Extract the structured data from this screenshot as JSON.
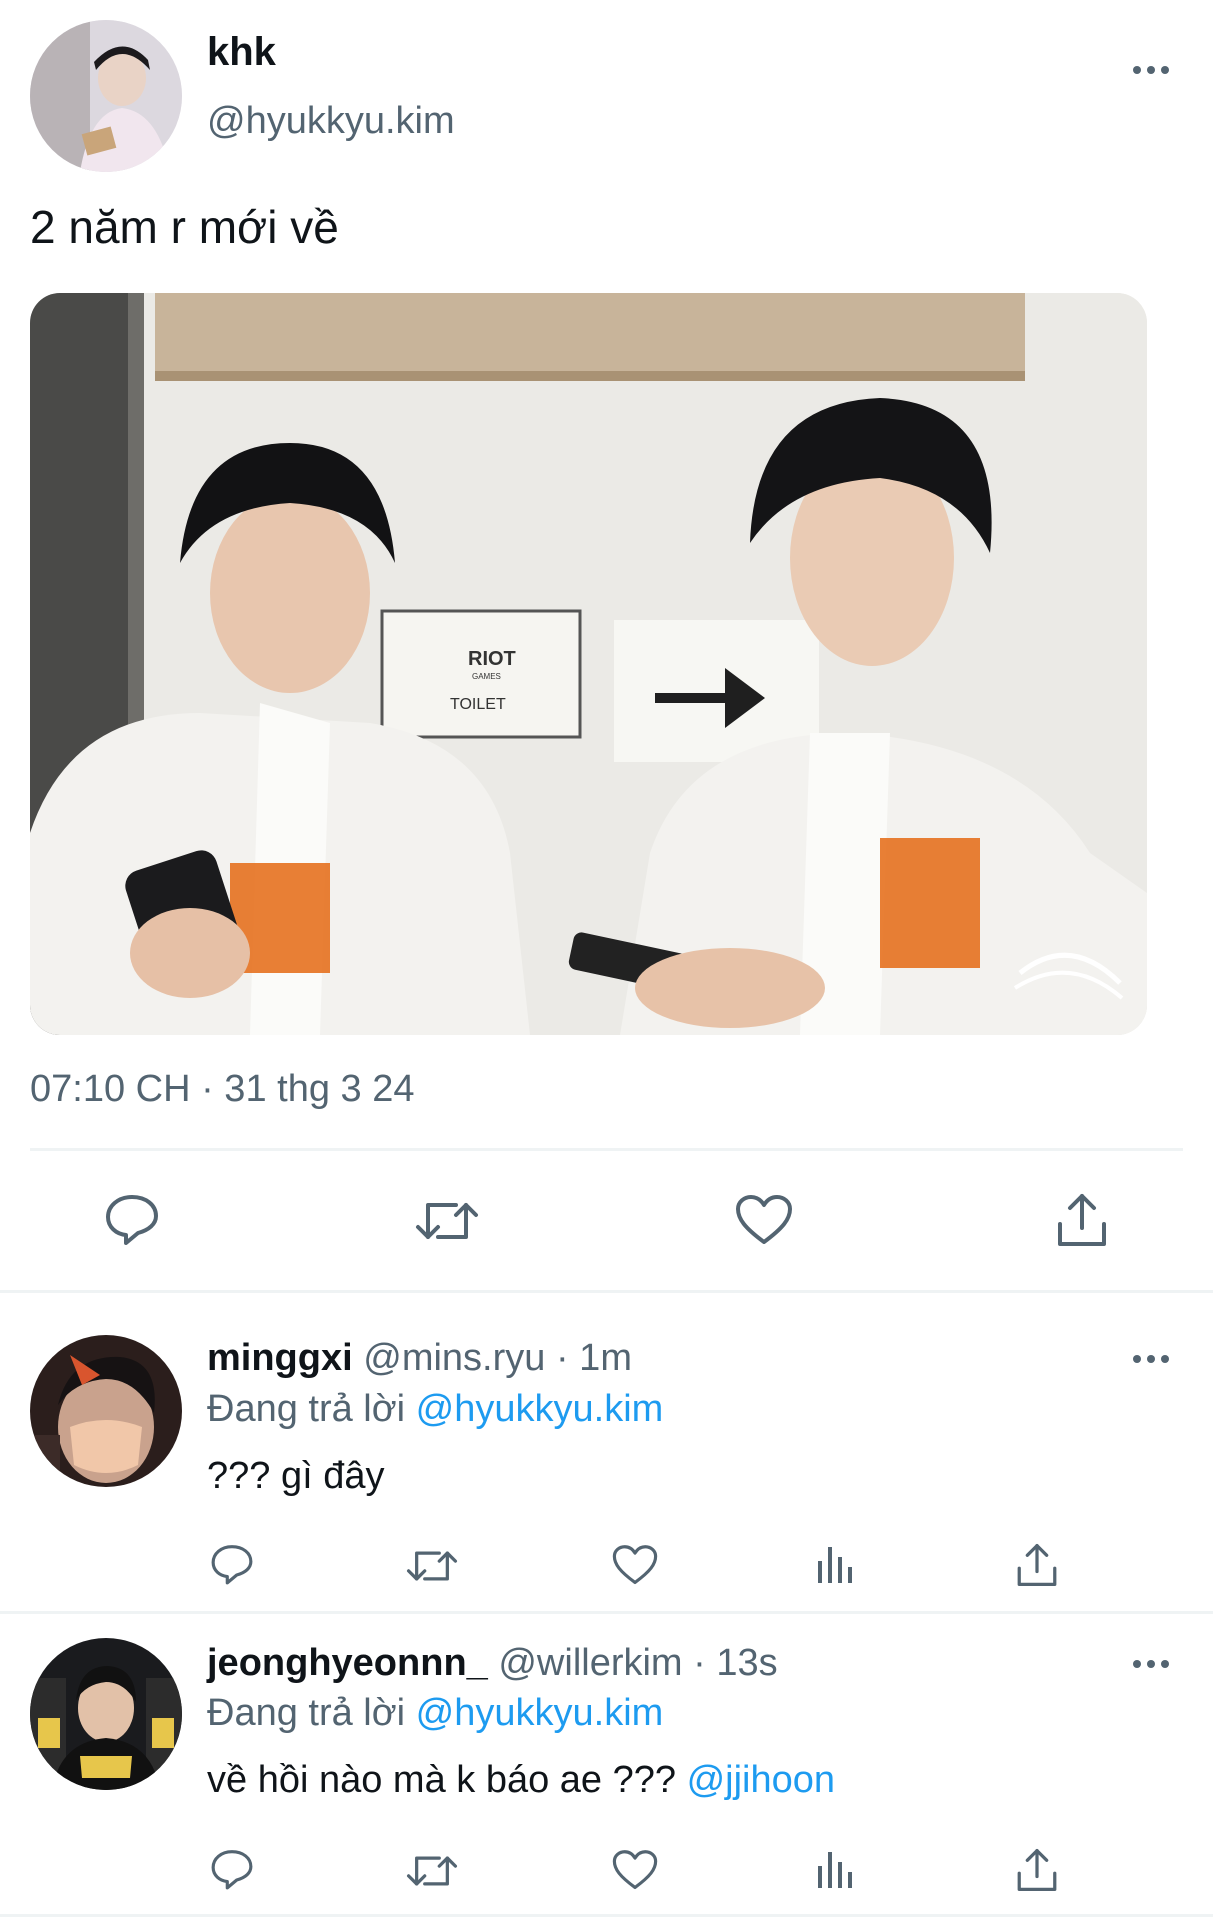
{
  "main_tweet": {
    "display_name": "khk",
    "handle": "@hyukkyu.kim",
    "text": "2 năm r mới về",
    "timestamp": "07:10 CH · 31 thg 3 24",
    "photo_signs": {
      "sign_brand": "RIOT",
      "sign_sub": "GAMES",
      "sign_text": "TOILET"
    },
    "actions": [
      "reply-icon",
      "retweet-icon",
      "like-icon",
      "share-icon"
    ]
  },
  "replies": [
    {
      "display_name": "minggxi",
      "handle": "@mins.ryu",
      "time": "· 1m",
      "replying_label": "Đang trả lời",
      "replying_to": "@hyukkyu.kim",
      "text": "??? gì đây",
      "mention": ""
    },
    {
      "display_name": "jeonghyeonnn_",
      "handle": "@willerkim",
      "time": "· 13s",
      "replying_label": "Đang trả lời",
      "replying_to": "@hyukkyu.kim",
      "text": "về hồi nào mà k báo ae ???",
      "mention": "@jjihoon"
    }
  ],
  "colors": {
    "text": "#0f1419",
    "muted": "#536471",
    "link": "#1d9bf0",
    "divider": "#eff3f4"
  }
}
